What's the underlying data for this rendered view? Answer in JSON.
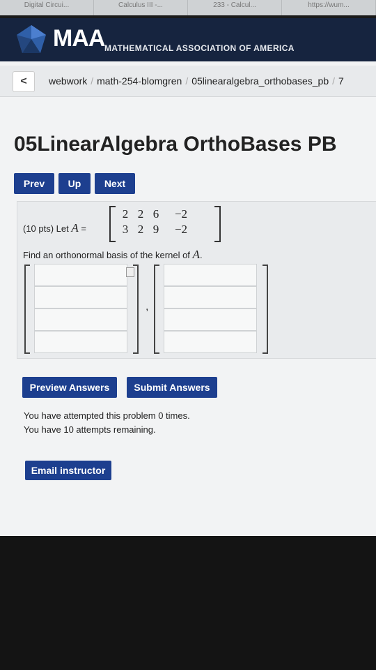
{
  "browser_tabs": [
    "Digital Circui...",
    "Calculus III -...",
    "233 - Calcul...",
    "https://wum..."
  ],
  "header": {
    "logo_text": "MAA",
    "org_name": "MATHEMATICAL ASSOCIATION OF AMERICA"
  },
  "breadcrumb": {
    "back_label": "<",
    "items": [
      "webwork",
      "math-254-blomgren",
      "05linearalgebra_orthobases_pb",
      "7"
    ]
  },
  "page_title": "05LinearAlgebra OrthoBases PB",
  "nav": {
    "prev": "Prev",
    "up": "Up",
    "next": "Next"
  },
  "problem": {
    "points": "(10 pts) Let",
    "var": "A",
    "equals": "=",
    "matrix": [
      [
        "2",
        "2",
        "6",
        "−2"
      ],
      [
        "3",
        "2",
        "9",
        "−2"
      ]
    ],
    "prompt": "Find an orthonormal basis of the kernel of",
    "prompt_end": ".",
    "vector_separator": ","
  },
  "answers": {
    "vector1": [
      "",
      "",
      "",
      ""
    ],
    "vector2": [
      "",
      "",
      "",
      ""
    ]
  },
  "buttons": {
    "preview": "Preview Answers",
    "submit": "Submit Answers",
    "email": "Email instructor"
  },
  "attempts": {
    "line1": "You have attempted this problem 0 times.",
    "line2": "You have 10 attempts remaining."
  },
  "colors": {
    "header_bg": "#16243f",
    "button_bg": "#1d3f8f"
  }
}
